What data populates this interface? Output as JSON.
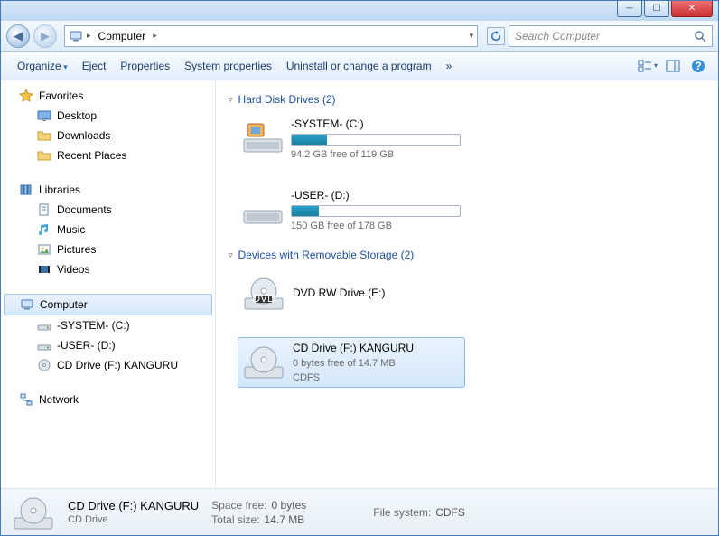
{
  "breadcrumb": {
    "level1": "Computer"
  },
  "search": {
    "placeholder": "Search Computer"
  },
  "toolbar": {
    "organize": "Organize",
    "eject": "Eject",
    "properties": "Properties",
    "system_properties": "System properties",
    "uninstall": "Uninstall or change a program",
    "more": "»"
  },
  "sidebar": {
    "favorites": {
      "label": "Favorites",
      "items": [
        {
          "label": "Desktop"
        },
        {
          "label": "Downloads"
        },
        {
          "label": "Recent Places"
        }
      ]
    },
    "libraries": {
      "label": "Libraries",
      "items": [
        {
          "label": "Documents"
        },
        {
          "label": "Music"
        },
        {
          "label": "Pictures"
        },
        {
          "label": "Videos"
        }
      ]
    },
    "computer": {
      "label": "Computer",
      "items": [
        {
          "label": "-SYSTEM- (C:)"
        },
        {
          "label": "-USER-  (D:)"
        },
        {
          "label": "CD Drive (F:) KANGURU"
        }
      ]
    },
    "network": {
      "label": "Network"
    }
  },
  "main": {
    "hdd_header": "Hard Disk Drives (2)",
    "removable_header": "Devices with Removable Storage (2)",
    "hdd": [
      {
        "name": "-SYSTEM- (C:)",
        "free": "94.2 GB free of 119 GB",
        "pct": 21
      },
      {
        "name": "-USER- (D:)",
        "free": "150 GB free of 178 GB",
        "pct": 16
      }
    ],
    "removable": [
      {
        "name": "DVD RW Drive (E:)",
        "type": "dvd"
      },
      {
        "name": "CD Drive (F:) KANGURU",
        "sub1": "0 bytes free of 14.7 MB",
        "sub2": "CDFS",
        "type": "cd",
        "selected": true
      }
    ]
  },
  "status": {
    "title": "CD Drive (F:) KANGURU",
    "subtitle": "CD Drive",
    "rows": [
      {
        "k": "Space free:",
        "v": "0 bytes"
      },
      {
        "k": "Total size:",
        "v": "14.7 MB"
      }
    ],
    "filesystem_k": "File system:",
    "filesystem_v": "CDFS"
  }
}
